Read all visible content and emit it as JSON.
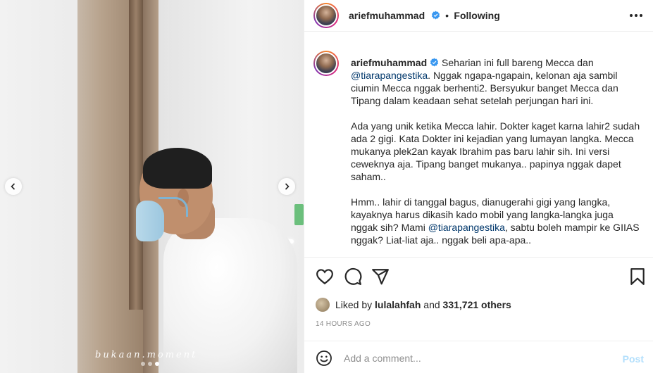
{
  "media": {
    "watermark": "bukaan.moment",
    "carousel": {
      "total": 3,
      "active": 3
    },
    "icons": {
      "prev": "chevron-left-icon",
      "next": "chevron-right-icon"
    }
  },
  "header": {
    "username": "ariefmuhammad",
    "separator": "•",
    "following_label": "Following",
    "icons": {
      "verified": "verified-badge-icon",
      "more": "more-options-icon"
    }
  },
  "caption": {
    "username": "ariefmuhammad",
    "p1_a": "Seharian ini full bareng Mecca dan ",
    "p1_mention": "@tiarapangestika",
    "p1_b": ". Nggak ngapa-ngapain, kelonan aja sambil ciumin Mecca nggak berhenti2. Bersyukur banget Mecca dan Tipang dalam keadaan sehat setelah perjungan hari ini.",
    "p2": "Ada yang unik ketika Mecca lahir. Dokter kaget karna lahir2 sudah ada 2 gigi. Kata Dokter ini kejadian yang lumayan langka. Mecca mukanya plek2an kayak Ibrahim pas baru lahir sih. Ini versi ceweknya aja. Tipang banget mukanya.. papinya nggak dapet saham..",
    "p3_a": "Hmm.. lahir di tanggal bagus, dianugerahi gigi yang langka, kayaknya harus dikasih kado mobil yang langka-langka juga nggak sih? Mami ",
    "p3_mention": "@tiarapangestika",
    "p3_b": ", sabtu boleh mampir ke GIIAS nggak? Liat-liat aja.. nggak beli apa-apa.."
  },
  "actions": {
    "icons": [
      "heart-icon",
      "comment-icon",
      "share-icon",
      "bookmark-icon"
    ]
  },
  "likes": {
    "prefix": "Liked by ",
    "user": "lulalahfah",
    "middle": " and ",
    "count": "331,721 others"
  },
  "timestamp": "14 HOURS AGO",
  "comment": {
    "placeholder": "Add a comment...",
    "post_label": "Post"
  },
  "colors": {
    "text": "#262626",
    "mention": "#00376b",
    "verified": "#3897f0",
    "muted": "#8e8e8e",
    "post_disabled": "#b2dffc"
  }
}
